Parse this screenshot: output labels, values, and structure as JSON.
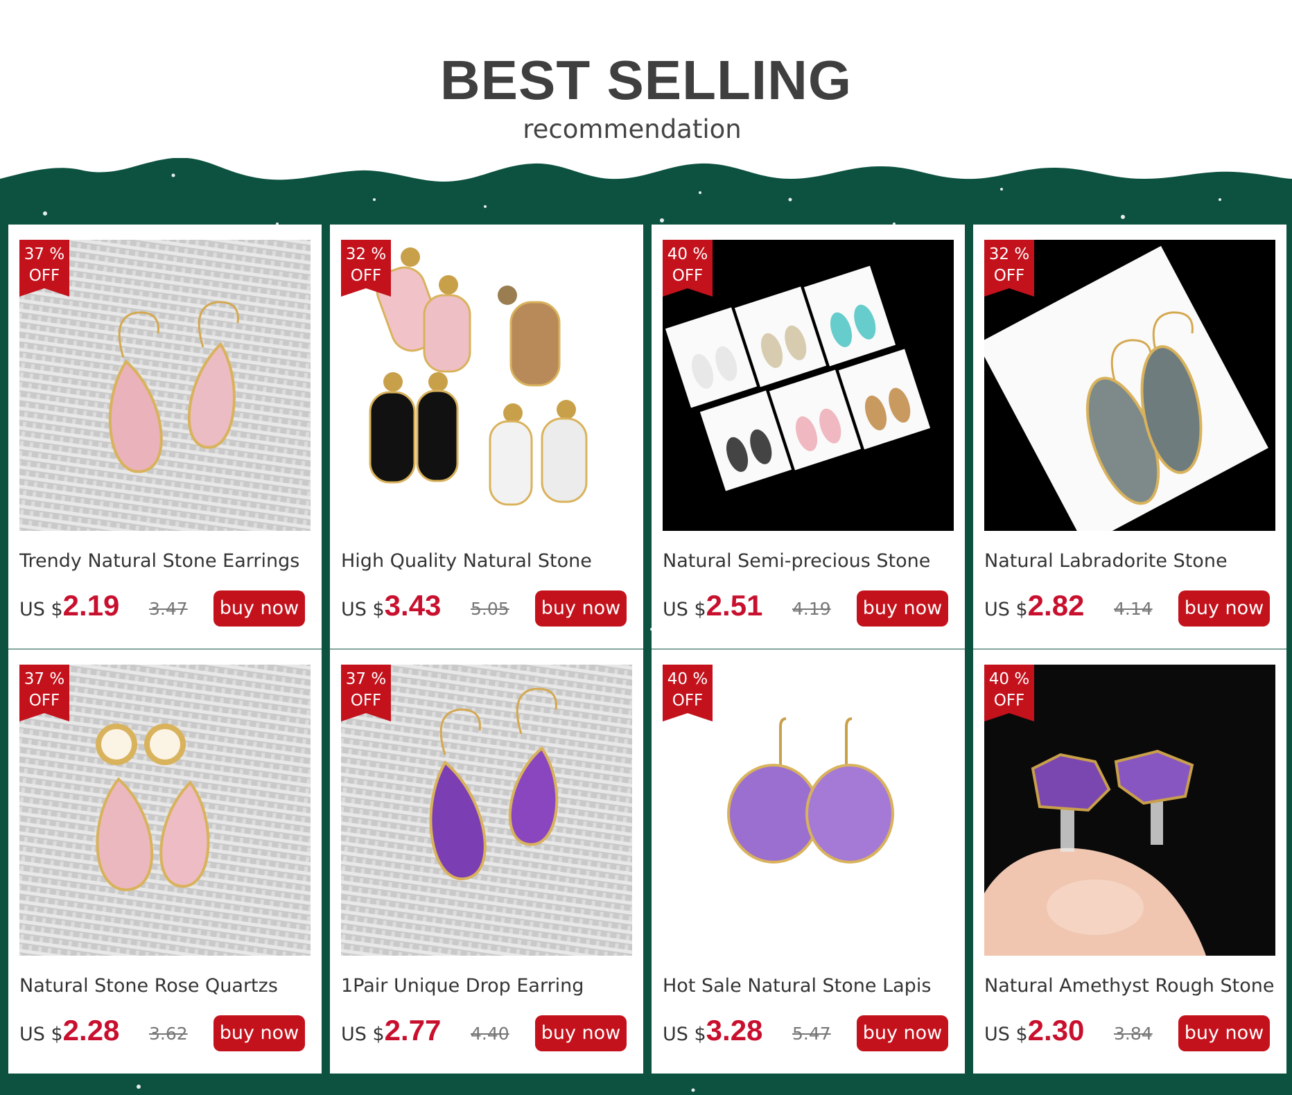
{
  "header": {
    "title": "BEST SELLING",
    "subtitle": "recommendation"
  },
  "colors": {
    "band": "#0d5240",
    "accent_red": "#c3121c",
    "price_red": "#c8102e"
  },
  "products": [
    {
      "discount_line1": "37 %",
      "discount_line2": "OFF",
      "title": "Trendy Natural Stone Earrings",
      "currency": "US $",
      "price": "2.19",
      "old_price": "3.47",
      "button": "buy now",
      "image": "rose-quartz-teardrop-earrings"
    },
    {
      "discount_line1": "32 %",
      "discount_line2": "OFF",
      "title": "High Quality Natural Stone",
      "currency": "US $",
      "price": "3.43",
      "old_price": "5.05",
      "button": "buy now",
      "image": "oval-stone-stud-drop-earrings"
    },
    {
      "discount_line1": "40 %",
      "discount_line2": "OFF",
      "title": "Natural Semi-precious Stone",
      "currency": "US $",
      "price": "2.51",
      "old_price": "4.19",
      "button": "buy now",
      "image": "earrings-on-cards-assortment"
    },
    {
      "discount_line1": "32 %",
      "discount_line2": "OFF",
      "title": "Natural Labradorite Stone",
      "currency": "US $",
      "price": "2.82",
      "old_price": "4.14",
      "button": "buy now",
      "image": "labradorite-marquise-earrings"
    },
    {
      "discount_line1": "37 %",
      "discount_line2": "OFF",
      "title": "Natural Stone Rose Quartzs",
      "currency": "US $",
      "price": "2.28",
      "old_price": "3.62",
      "button": "buy now",
      "image": "pearl-rose-quartz-drop-earrings"
    },
    {
      "discount_line1": "37 %",
      "discount_line2": "OFF",
      "title": "1Pair Unique Drop Earring",
      "currency": "US $",
      "price": "2.77",
      "old_price": "4.40",
      "button": "buy now",
      "image": "amethyst-druzy-teardrop-earrings"
    },
    {
      "discount_line1": "40 %",
      "discount_line2": "OFF",
      "title": "Hot Sale Natural Stone Lapis",
      "currency": "US $",
      "price": "3.28",
      "old_price": "5.47",
      "button": "buy now",
      "image": "amethyst-oval-hook-earrings"
    },
    {
      "discount_line1": "40 %",
      "discount_line2": "OFF",
      "title": "Natural Amethyst Rough Stone",
      "currency": "US $",
      "price": "2.30",
      "old_price": "3.84",
      "button": "buy now",
      "image": "amethyst-rough-stud-earrings"
    }
  ]
}
